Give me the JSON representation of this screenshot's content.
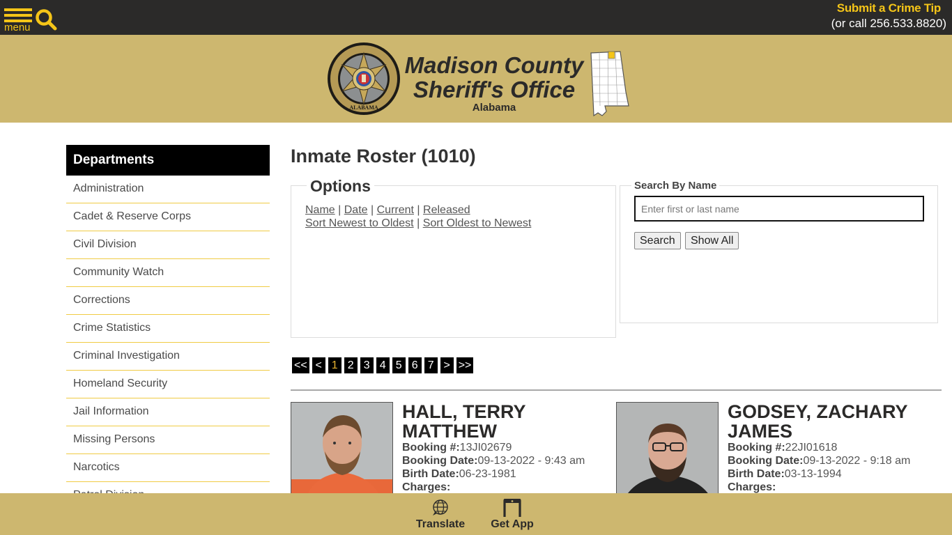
{
  "topbar": {
    "menu_label": "menu",
    "menu_icon": "hamburger-icon",
    "search_icon": "search-icon",
    "tip_link": "Submit a Crime Tip",
    "tip_call": "(or call 256.533.8820)"
  },
  "header": {
    "seal_icon": "sheriff-badge-seal",
    "title_line1": "Madison County",
    "title_line2": "Sheriff's Office",
    "subtitle": "Alabama",
    "map_icon": "alabama-county-map"
  },
  "sidebar": {
    "heading": "Departments",
    "items": [
      {
        "label": "Administration"
      },
      {
        "label": "Cadet & Reserve Corps"
      },
      {
        "label": "Civil Division"
      },
      {
        "label": "Community Watch"
      },
      {
        "label": "Corrections"
      },
      {
        "label": "Crime Statistics"
      },
      {
        "label": "Criminal Investigation"
      },
      {
        "label": "Homeland Security"
      },
      {
        "label": "Jail Information"
      },
      {
        "label": "Missing Persons"
      },
      {
        "label": "Narcotics"
      },
      {
        "label": "Patrol Division"
      }
    ]
  },
  "main": {
    "title": "Inmate Roster (1010)",
    "options": {
      "legend": "Options",
      "filter_links": [
        "Name",
        "Date",
        "Current",
        "Released"
      ],
      "sort_links": [
        "Sort Newest to Oldest",
        "Sort Oldest to Newest"
      ],
      "separator": "|"
    },
    "search": {
      "legend": "Search By Name",
      "placeholder": "Enter first or last name",
      "value": "",
      "search_button": "Search",
      "show_all_button": "Show All"
    },
    "pagination": {
      "first": "<<",
      "prev": "<",
      "pages": [
        "1",
        "2",
        "3",
        "4",
        "5",
        "6",
        "7"
      ],
      "current_page": "1",
      "next": ">",
      "last": ">>"
    },
    "inmates": [
      {
        "name": "HALL, TERRY MATTHEW",
        "booking_number_label": "Booking #:",
        "booking_number": "13JI02679",
        "booking_date_label": "Booking Date:",
        "booking_date": "09-13-2022 - 9:43 am",
        "birth_date_label": "Birth Date:",
        "birth_date": "06-23-1981",
        "charges_label": "Charges:"
      },
      {
        "name": "GODSEY, ZACHARY JAMES",
        "booking_number_label": "Booking #:",
        "booking_number": "22JI01618",
        "booking_date_label": "Booking Date:",
        "booking_date": "09-13-2022 - 9:18 am",
        "birth_date_label": "Birth Date:",
        "birth_date": "03-13-1994",
        "charges_label": "Charges:"
      }
    ]
  },
  "footer": {
    "translate_label": "Translate",
    "getapp_label": "Get App"
  },
  "colors": {
    "topbar_bg": "#2b2a29",
    "accent_yellow": "#f5c518",
    "header_gold": "#cdb76f",
    "sidebar_divider": "#f0cb43",
    "pager_active": "#e6b230"
  }
}
